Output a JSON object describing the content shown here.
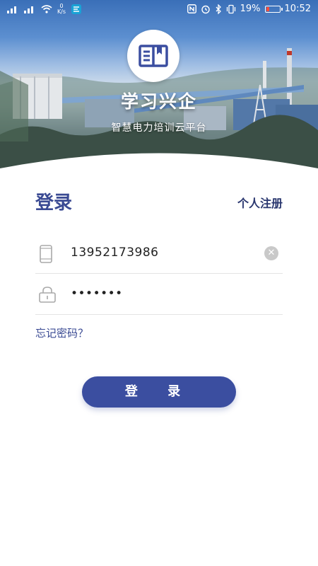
{
  "status_bar": {
    "speed_value": "0",
    "speed_unit": "K/s",
    "battery": "19%",
    "time": "10:52",
    "battery_color": "#ff4d3b"
  },
  "header": {
    "app_name": "学习兴企",
    "subtitle": "智慧电力培训云平台",
    "logo_icon": "book-icon"
  },
  "login": {
    "title": "登录",
    "register_link": "个人注册",
    "phone_value": "13952173986",
    "password_value": "•••••••",
    "forgot_link": "忘记密码？",
    "submit_label": "登 录"
  },
  "colors": {
    "primary": "#3b4ea0",
    "title_text": "#3a4a93",
    "divider": "#e4e4e4"
  }
}
